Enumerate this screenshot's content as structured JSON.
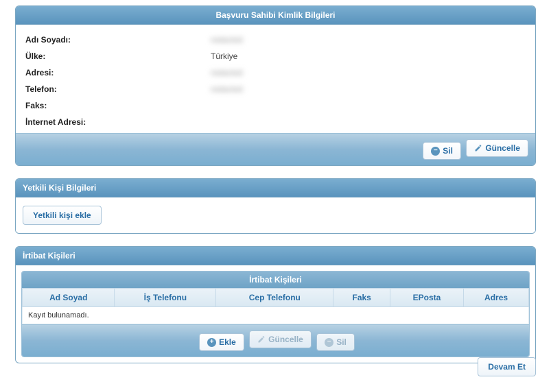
{
  "applicant_panel": {
    "title": "Başvuru Sahibi Kimlik Bilgileri",
    "rows": {
      "name_label": "Adı Soyadı:",
      "name_value": "redacted",
      "country_label": "Ülke:",
      "country_value": "Türkiye",
      "address_label": "Adresi:",
      "address_value": "redacted",
      "phone_label": "Telefon:",
      "phone_value": "redacted",
      "fax_label": "Faks:",
      "fax_value": "",
      "web_label": "İnternet Adresi:",
      "web_value": ""
    },
    "buttons": {
      "delete": "Sil",
      "update": "Güncelle"
    }
  },
  "authorized_panel": {
    "title": "Yetkili Kişi Bilgileri",
    "add_button": "Yetkili kişi ekle"
  },
  "contacts_panel": {
    "title": "İrtibat Kişileri",
    "inner_title": "İrtibat Kişileri",
    "columns": [
      "Ad Soyad",
      "İş Telefonu",
      "Cep Telefonu",
      "Faks",
      "EPosta",
      "Adres"
    ],
    "empty_text": "Kayıt bulunamadı.",
    "buttons": {
      "add": "Ekle",
      "update": "Güncelle",
      "delete": "Sil"
    }
  },
  "footer": {
    "continue": "Devam Et"
  }
}
